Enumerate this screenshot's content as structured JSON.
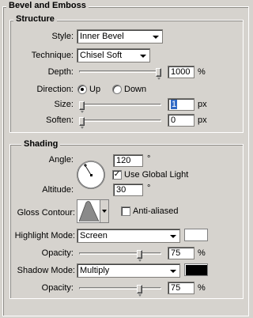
{
  "title": "Bevel and Emboss",
  "structure": {
    "legend": "Structure",
    "style_label": "Style:",
    "style_value": "Inner Bevel",
    "technique_label": "Technique:",
    "technique_value": "Chisel Soft",
    "depth_label": "Depth:",
    "depth_value": "1000",
    "depth_slider": 1.0,
    "percent_unit": "%",
    "direction_label": "Direction:",
    "direction_up": "Up",
    "direction_down": "Down",
    "direction_selected": "Up",
    "size_label": "Size:",
    "size_value": "1",
    "size_slider": 0.0,
    "px_unit": "px",
    "soften_label": "Soften:",
    "soften_value": "0",
    "soften_slider": 0.0
  },
  "shading": {
    "legend": "Shading",
    "angle_label": "Angle:",
    "angle_value": "120",
    "degree_unit": "°",
    "global_light_label": "Use Global Light",
    "global_light_checked": true,
    "check_glyph": "✓",
    "altitude_label": "Altitude:",
    "altitude_value": "30",
    "gloss_contour_label": "Gloss Contour:",
    "anti_aliased_label": "Anti-aliased",
    "anti_aliased_checked": false,
    "highlight_mode_label": "Highlight Mode:",
    "highlight_mode_value": "Screen",
    "highlight_color": "#ffffff",
    "highlight_opacity_label": "Opacity:",
    "highlight_opacity_value": "75",
    "highlight_opacity_slider": 0.75,
    "shadow_mode_label": "Shadow Mode:",
    "shadow_mode_value": "Multiply",
    "shadow_color": "#000000",
    "shadow_opacity_label": "Opacity:",
    "shadow_opacity_value": "75",
    "shadow_opacity_slider": 0.75,
    "percent_unit": "%"
  }
}
